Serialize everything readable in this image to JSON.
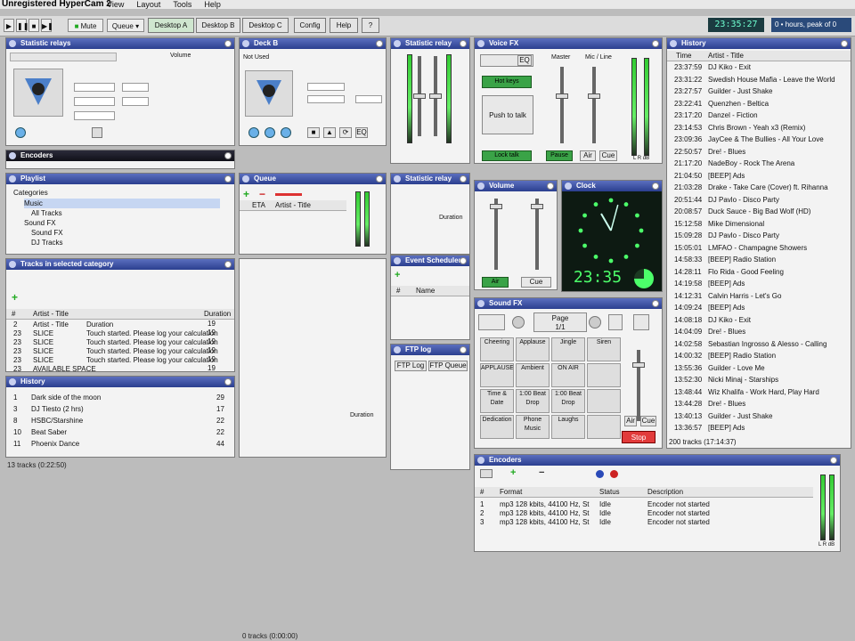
{
  "app": {
    "title": "Unregistered HyperCam 2"
  },
  "menu": [
    "View",
    "Layout",
    "Tools",
    "Help"
  ],
  "toolbar": {
    "mute_label": "Mute",
    "queue_label": "Queue",
    "tabs": [
      "Desktop A",
      "Desktop B",
      "Desktop C",
      "Config",
      "Help",
      "?"
    ],
    "time": "23:35:27",
    "free_text": "0 • hours, peak of 0"
  },
  "statistic_relays": {
    "title": "Statistic relays",
    "volume_label": "Volume"
  },
  "deck_b": {
    "title": "Deck B",
    "status": "Not Used",
    "eq_label": "EQ"
  },
  "statistic_relay2": {
    "title": "Statistic relay"
  },
  "voice_fx": {
    "title": "Voice FX",
    "master_label": "Master",
    "mic_label": "Mic / Line",
    "eq_label": "EQ",
    "hotkeys_label": "Hot keys",
    "push_talk_label": "Push to talk",
    "lock_talk_label": "Lock talk",
    "pause_label": "Pause",
    "air_label": "Air",
    "cue_label": "Cue",
    "lr_label": "L R dB"
  },
  "history": {
    "title": "History",
    "columns": [
      "Time",
      "Artist - Title"
    ],
    "rows": [
      [
        "23:37:59",
        "DJ Kiko - Exit"
      ],
      [
        "23:31:22",
        "Swedish House Mafia - Leave the World"
      ],
      [
        "23:27:57",
        "Guilder - Just Shake"
      ],
      [
        "23:22:41",
        "Quenzhen - Beltica"
      ],
      [
        "23:17:20",
        "Danzel - Fiction"
      ],
      [
        "23:14:53",
        "Chris Brown - Yeah x3 (Remix)"
      ],
      [
        "23:09:36",
        "JayCee & The Bullies - All Your Love"
      ],
      [
        "22:50:57",
        "Dre! - Blues"
      ],
      [
        "21:17:20",
        "NadeBoy - Rock The Arena"
      ],
      [
        "21:04:50",
        "[BEEP] Ads"
      ],
      [
        "21:03:28",
        "Drake - Take Care (Cover) ft. Rihanna"
      ],
      [
        "20:51:44",
        "DJ Pavlo - Disco Party"
      ],
      [
        "20:08:57",
        "Duck Sauce - Big Bad Wolf (HD)"
      ],
      [
        "15:12:58",
        "Mike Dimensional"
      ],
      [
        "15:09:28",
        "DJ Pavlo - Disco Party"
      ],
      [
        "15:05:01",
        "LMFAO - Champagne Showers"
      ],
      [
        "14:58:33",
        "[BEEP] Radio Station"
      ],
      [
        "14:28:11",
        "Flo Rida - Good Feeling"
      ],
      [
        "14:19:58",
        "[BEEP] Ads"
      ],
      [
        "14:12:31",
        "Calvin Harris - Let's Go"
      ],
      [
        "14:09:24",
        "[BEEP] Ads"
      ],
      [
        "14:08:18",
        "DJ Kiko - Exit"
      ],
      [
        "14:04:09",
        "Dre! - Blues"
      ],
      [
        "14:02:58",
        "Sebastian Ingrosso & Alesso - Calling"
      ],
      [
        "14:00:32",
        "[BEEP] Radio Station"
      ],
      [
        "13:55:36",
        "Guilder - Love Me"
      ],
      [
        "13:52:30",
        "Nicki Minaj - Starships"
      ],
      [
        "13:48:44",
        "Wiz Khalifa - Work Hard, Play Hard"
      ],
      [
        "13:44:28",
        "Dre! - Blues"
      ],
      [
        "13:40:13",
        "Guilder - Just Shake"
      ],
      [
        "13:36:57",
        "[BEEP] Ads"
      ]
    ],
    "status": "200 tracks (17:14:37)"
  },
  "encoders_left": {
    "title": "Encoders"
  },
  "playlist": {
    "title": "Playlist",
    "categories_label": "Categories",
    "items": [
      "Music",
      "All Tracks",
      "Sound FX",
      "Sound FX",
      "DJ Tracks"
    ]
  },
  "queue": {
    "title": "Queue",
    "col_eta": "ETA",
    "col_title": "Artist - Title",
    "col_duration": "Duration"
  },
  "statistic_relay3": {
    "title": "Statistic relay"
  },
  "tracks": {
    "title": "Tracks in selected category",
    "columns": [
      "#",
      "Artist - Title",
      "Duration"
    ],
    "rows": [
      [
        "2",
        "Artist - Title",
        "Duration"
      ],
      [
        "23",
        "SLICE",
        "Touch started. Please log your calculation"
      ],
      [
        "23",
        "SLICE",
        "Touch started. Please log your calculation"
      ],
      [
        "23",
        "SLICE",
        "Touch started. Please log your calculation"
      ],
      [
        "23",
        "SLICE",
        "Touch started. Please log your calculation"
      ],
      [
        "23",
        "AVAILABLE SPACE",
        ""
      ]
    ],
    "durations": [
      "19",
      "19",
      "19",
      "19",
      "19",
      "19"
    ]
  },
  "event_scheduler": {
    "title": "Event Scheduler",
    "col_name": "Name"
  },
  "volume": {
    "title": "Volume",
    "air_label": "Air",
    "cue_label": "Cue"
  },
  "clock": {
    "title": "Clock",
    "time": "23:35"
  },
  "history_mini": {
    "title": "History",
    "rows": [
      [
        "1",
        "Dark side of the moon",
        "29"
      ],
      [
        "3",
        "DJ Tiesto (2 hrs)",
        "17"
      ],
      [
        "8",
        "HSBC/Starshine",
        "22"
      ],
      [
        "10",
        "Beat Saber",
        "22"
      ],
      [
        "11",
        "Phoenix Dance",
        "44"
      ]
    ],
    "col_duration": "Duration",
    "status": "13 tracks (0:22:50)"
  },
  "ftp_log": {
    "title": "FTP log",
    "tabs": [
      "FTP Log",
      "FTP Queue"
    ]
  },
  "sound_fx": {
    "title": "Sound FX",
    "page_label": "Page",
    "page_value": "1/1",
    "cells": [
      "Cheering",
      "Applause",
      "Jingle",
      "Siren",
      "APPLAUSE",
      "Ambient",
      "ON AIR",
      "",
      "Time & Date",
      "1:00 Beat Drop",
      "1:00 Beat Drop",
      "",
      "Dedication",
      "Phone Music",
      "Laughs",
      ""
    ],
    "air_label": "Air",
    "cue_label": "Cue",
    "stop_label": "Stop"
  },
  "encoders": {
    "title": "Encoders",
    "columns": [
      "#",
      "Format",
      "Status",
      "Description"
    ],
    "rows": [
      [
        "1",
        "mp3 128 kbits, 44100 Hz, St",
        "Idle",
        "Encoder not started"
      ],
      [
        "2",
        "mp3 128 kbits, 44100 Hz, St",
        "Idle",
        "Encoder not started"
      ],
      [
        "3",
        "mp3 128 kbits, 44100 Hz, St",
        "Idle",
        "Encoder not started"
      ]
    ],
    "lr_label": "L R dB"
  },
  "queue_status": "0 tracks (0:00:00)"
}
